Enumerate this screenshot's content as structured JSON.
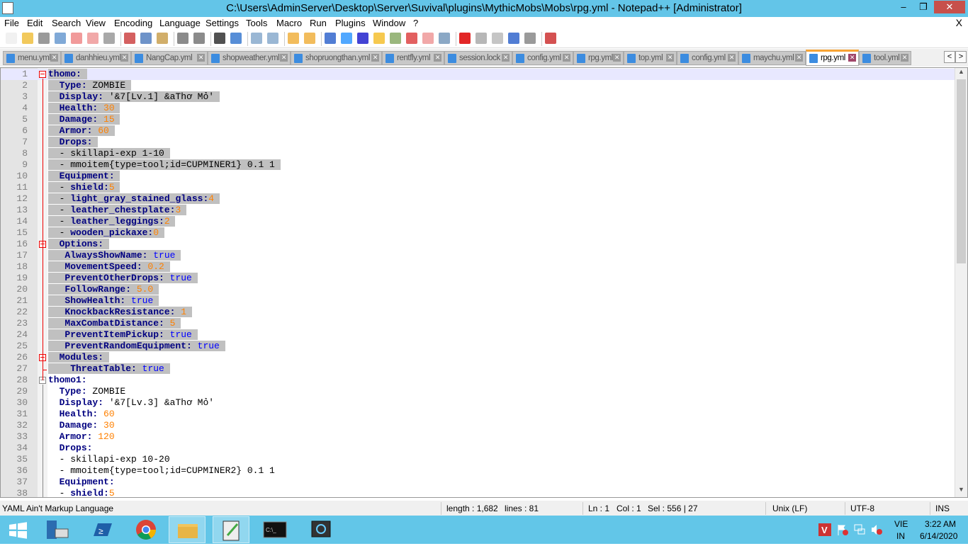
{
  "window": {
    "title": "C:\\Users\\AdminServer\\Desktop\\Server\\Suvival\\plugins\\MythicMobs\\Mobs\\rpg.yml - Notepad++ [Administrator]",
    "minimize": "‒",
    "restore": "❐",
    "close": "✕"
  },
  "menu": [
    "File",
    "Edit",
    "Search",
    "View",
    "Encoding",
    "Language",
    "Settings",
    "Tools",
    "Macro",
    "Run",
    "Plugins",
    "Window",
    "?"
  ],
  "menu_close": "X",
  "tabs": [
    {
      "label": "menu.yml"
    },
    {
      "label": "danhhieu.yml"
    },
    {
      "label": "NangCap.yml"
    },
    {
      "label": "shopweather.yml"
    },
    {
      "label": "shopruongthan.yml"
    },
    {
      "label": "rentfly.yml"
    },
    {
      "label": "session.lock"
    },
    {
      "label": "config.yml"
    },
    {
      "label": "rpg.yml"
    },
    {
      "label": "top.yml"
    },
    {
      "label": "config.yml"
    },
    {
      "label": "maychu.yml"
    },
    {
      "label": "rpg.yml",
      "active": true
    },
    {
      "label": "tool.yml"
    }
  ],
  "tab_nav": [
    "<",
    ">"
  ],
  "lines": [
    [
      [
        "k",
        "thomo:"
      ]
    ],
    [
      [
        "p",
        "  "
      ],
      [
        "k",
        "Type:"
      ],
      [
        "p",
        " ZOMBIE"
      ]
    ],
    [
      [
        "p",
        "  "
      ],
      [
        "k",
        "Display:"
      ],
      [
        "p",
        " '&7[Lv.1] &aThơ Mỏ'"
      ]
    ],
    [
      [
        "p",
        "  "
      ],
      [
        "k",
        "Health:"
      ],
      [
        "n",
        " 30"
      ]
    ],
    [
      [
        "p",
        "  "
      ],
      [
        "k",
        "Damage:"
      ],
      [
        "n",
        " 15"
      ]
    ],
    [
      [
        "p",
        "  "
      ],
      [
        "k",
        "Armor:"
      ],
      [
        "n",
        " 60"
      ]
    ],
    [
      [
        "p",
        "  "
      ],
      [
        "k",
        "Drops:"
      ]
    ],
    [
      [
        "p",
        "  - skillapi-exp 1-10"
      ]
    ],
    [
      [
        "p",
        "  - mmoitem{type=tool;id=CUPMINER1} 0.1 1"
      ]
    ],
    [
      [
        "p",
        "  "
      ],
      [
        "k",
        "Equipment:"
      ]
    ],
    [
      [
        "p",
        "  - "
      ],
      [
        "k",
        "shield:"
      ],
      [
        "n",
        "5"
      ]
    ],
    [
      [
        "p",
        "  - "
      ],
      [
        "k",
        "light_gray_stained_glass:"
      ],
      [
        "n",
        "4"
      ]
    ],
    [
      [
        "p",
        "  - "
      ],
      [
        "k",
        "leather_chestplate:"
      ],
      [
        "n",
        "3"
      ]
    ],
    [
      [
        "p",
        "  - "
      ],
      [
        "k",
        "leather_leggings:"
      ],
      [
        "n",
        "2"
      ]
    ],
    [
      [
        "p",
        "  - "
      ],
      [
        "k",
        "wooden_pickaxe:"
      ],
      [
        "n",
        "0"
      ]
    ],
    [
      [
        "p",
        "  "
      ],
      [
        "k",
        "Options:"
      ]
    ],
    [
      [
        "p",
        "   "
      ],
      [
        "k",
        "AlwaysShowName:"
      ],
      [
        "b",
        " true"
      ]
    ],
    [
      [
        "p",
        "   "
      ],
      [
        "k",
        "MovementSpeed:"
      ],
      [
        "n",
        " 0.2"
      ]
    ],
    [
      [
        "p",
        "   "
      ],
      [
        "k",
        "PreventOtherDrops:"
      ],
      [
        "b",
        " true"
      ]
    ],
    [
      [
        "p",
        "   "
      ],
      [
        "k",
        "FollowRange:"
      ],
      [
        "n",
        " 5.0"
      ]
    ],
    [
      [
        "p",
        "   "
      ],
      [
        "k",
        "ShowHealth:"
      ],
      [
        "b",
        " true"
      ]
    ],
    [
      [
        "p",
        "   "
      ],
      [
        "k",
        "KnockbackResistance:"
      ],
      [
        "n",
        " 1"
      ]
    ],
    [
      [
        "p",
        "   "
      ],
      [
        "k",
        "MaxCombatDistance:"
      ],
      [
        "n",
        " 5"
      ]
    ],
    [
      [
        "p",
        "   "
      ],
      [
        "k",
        "PreventItemPickup:"
      ],
      [
        "b",
        " true"
      ]
    ],
    [
      [
        "p",
        "   "
      ],
      [
        "k",
        "PreventRandomEquipment:"
      ],
      [
        "b",
        " true"
      ]
    ],
    [
      [
        "p",
        "  "
      ],
      [
        "k",
        "Modules:"
      ]
    ],
    [
      [
        "p",
        "    "
      ],
      [
        "k",
        "ThreatTable:"
      ],
      [
        "b",
        " true"
      ]
    ],
    [
      [
        "k",
        "thomo1:"
      ]
    ],
    [
      [
        "p",
        "  "
      ],
      [
        "k",
        "Type:"
      ],
      [
        "p",
        " ZOMBIE"
      ]
    ],
    [
      [
        "p",
        "  "
      ],
      [
        "k",
        "Display:"
      ],
      [
        "p",
        " '&7[Lv.3] &aThơ Mỏ'"
      ]
    ],
    [
      [
        "p",
        "  "
      ],
      [
        "k",
        "Health:"
      ],
      [
        "n",
        " 60"
      ]
    ],
    [
      [
        "p",
        "  "
      ],
      [
        "k",
        "Damage:"
      ],
      [
        "n",
        " 30"
      ]
    ],
    [
      [
        "p",
        "  "
      ],
      [
        "k",
        "Armor:"
      ],
      [
        "n",
        " 120"
      ]
    ],
    [
      [
        "p",
        "  "
      ],
      [
        "k",
        "Drops:"
      ]
    ],
    [
      [
        "p",
        "  - skillapi-exp 10-20"
      ]
    ],
    [
      [
        "p",
        "  - mmoitem{type=tool;id=CUPMINER2} 0.1 1"
      ]
    ],
    [
      [
        "p",
        "  "
      ],
      [
        "k",
        "Equipment:"
      ]
    ],
    [
      [
        "p",
        "  - "
      ],
      [
        "k",
        "shield:"
      ],
      [
        "n",
        "5"
      ]
    ]
  ],
  "selected_lines": 27,
  "status": {
    "language": "YAML Ain't Markup Language",
    "length": "length : 1,682",
    "lines": "lines : 81",
    "ln": "Ln : 1",
    "col": "Col : 1",
    "sel": "Sel : 556 | 27",
    "eol": "Unix (LF)",
    "encoding": "UTF-8",
    "mode": "INS"
  },
  "tray": {
    "lang1": "VIE",
    "lang2": "IN",
    "time": "3:22 AM",
    "date": "6/14/2020"
  },
  "colors": {
    "key": "#000080",
    "number": "#ff8000",
    "bool": "#0000ff",
    "selection": "#c0c0c0",
    "titlebar": "#63c5e8"
  }
}
